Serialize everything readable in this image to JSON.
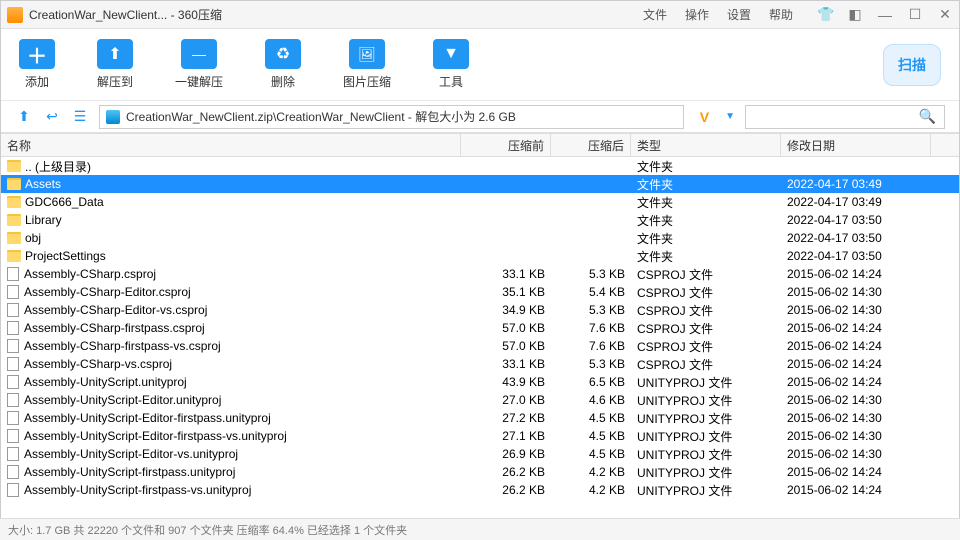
{
  "window": {
    "title": "CreationWar_NewClient... - 360压缩"
  },
  "menu": {
    "file": "文件",
    "operate": "操作",
    "settings": "设置",
    "help": "帮助"
  },
  "toolbar": {
    "add": "添加",
    "extract_to": "解压到",
    "one_click": "一键解压",
    "delete": "删除",
    "image_compress": "图片压缩",
    "tools": "工具",
    "scan": "扫描"
  },
  "nav": {
    "path": "CreationWar_NewClient.zip\\CreationWar_NewClient - 解包大小为 2.6 GB",
    "v": "V"
  },
  "headers": {
    "name": "名称",
    "before": "压缩前",
    "after": "压缩后",
    "type": "类型",
    "date": "修改日期"
  },
  "rows": [
    {
      "icon": "folder",
      "name": ".. (上级目录)",
      "before": "",
      "after": "",
      "type": "文件夹",
      "date": "",
      "sel": false
    },
    {
      "icon": "folder",
      "name": "Assets",
      "before": "",
      "after": "",
      "type": "文件夹",
      "date": "2022-04-17 03:49",
      "sel": true
    },
    {
      "icon": "folder",
      "name": "GDC666_Data",
      "before": "",
      "after": "",
      "type": "文件夹",
      "date": "2022-04-17 03:49",
      "sel": false
    },
    {
      "icon": "folder",
      "name": "Library",
      "before": "",
      "after": "",
      "type": "文件夹",
      "date": "2022-04-17 03:50",
      "sel": false
    },
    {
      "icon": "folder",
      "name": "obj",
      "before": "",
      "after": "",
      "type": "文件夹",
      "date": "2022-04-17 03:50",
      "sel": false
    },
    {
      "icon": "folder",
      "name": "ProjectSettings",
      "before": "",
      "after": "",
      "type": "文件夹",
      "date": "2022-04-17 03:50",
      "sel": false
    },
    {
      "icon": "file",
      "name": "Assembly-CSharp.csproj",
      "before": "33.1 KB",
      "after": "5.3 KB",
      "type": "CSPROJ 文件",
      "date": "2015-06-02 14:24",
      "sel": false
    },
    {
      "icon": "file",
      "name": "Assembly-CSharp-Editor.csproj",
      "before": "35.1 KB",
      "after": "5.4 KB",
      "type": "CSPROJ 文件",
      "date": "2015-06-02 14:30",
      "sel": false
    },
    {
      "icon": "file",
      "name": "Assembly-CSharp-Editor-vs.csproj",
      "before": "34.9 KB",
      "after": "5.3 KB",
      "type": "CSPROJ 文件",
      "date": "2015-06-02 14:30",
      "sel": false
    },
    {
      "icon": "file",
      "name": "Assembly-CSharp-firstpass.csproj",
      "before": "57.0 KB",
      "after": "7.6 KB",
      "type": "CSPROJ 文件",
      "date": "2015-06-02 14:24",
      "sel": false
    },
    {
      "icon": "file",
      "name": "Assembly-CSharp-firstpass-vs.csproj",
      "before": "57.0 KB",
      "after": "7.6 KB",
      "type": "CSPROJ 文件",
      "date": "2015-06-02 14:24",
      "sel": false
    },
    {
      "icon": "file",
      "name": "Assembly-CSharp-vs.csproj",
      "before": "33.1 KB",
      "after": "5.3 KB",
      "type": "CSPROJ 文件",
      "date": "2015-06-02 14:24",
      "sel": false
    },
    {
      "icon": "file",
      "name": "Assembly-UnityScript.unityproj",
      "before": "43.9 KB",
      "after": "6.5 KB",
      "type": "UNITYPROJ 文件",
      "date": "2015-06-02 14:24",
      "sel": false
    },
    {
      "icon": "file",
      "name": "Assembly-UnityScript-Editor.unityproj",
      "before": "27.0 KB",
      "after": "4.6 KB",
      "type": "UNITYPROJ 文件",
      "date": "2015-06-02 14:30",
      "sel": false
    },
    {
      "icon": "file",
      "name": "Assembly-UnityScript-Editor-firstpass.unityproj",
      "before": "27.2 KB",
      "after": "4.5 KB",
      "type": "UNITYPROJ 文件",
      "date": "2015-06-02 14:30",
      "sel": false
    },
    {
      "icon": "file",
      "name": "Assembly-UnityScript-Editor-firstpass-vs.unityproj",
      "before": "27.1 KB",
      "after": "4.5 KB",
      "type": "UNITYPROJ 文件",
      "date": "2015-06-02 14:30",
      "sel": false
    },
    {
      "icon": "file",
      "name": "Assembly-UnityScript-Editor-vs.unityproj",
      "before": "26.9 KB",
      "after": "4.5 KB",
      "type": "UNITYPROJ 文件",
      "date": "2015-06-02 14:30",
      "sel": false
    },
    {
      "icon": "file",
      "name": "Assembly-UnityScript-firstpass.unityproj",
      "before": "26.2 KB",
      "after": "4.2 KB",
      "type": "UNITYPROJ 文件",
      "date": "2015-06-02 14:24",
      "sel": false
    },
    {
      "icon": "file",
      "name": "Assembly-UnityScript-firstpass-vs.unityproj",
      "before": "26.2 KB",
      "after": "4.2 KB",
      "type": "UNITYPROJ 文件",
      "date": "2015-06-02 14:24",
      "sel": false
    }
  ],
  "status": "大小: 1.7 GB 共 22220 个文件和 907 个文件夹 压缩率 64.4% 已经选择 1 个文件夹"
}
